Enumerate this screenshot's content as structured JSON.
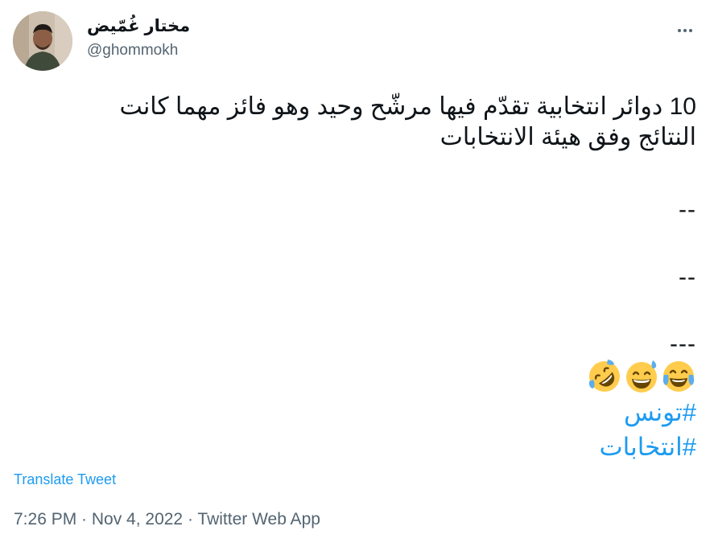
{
  "tweet": {
    "author": {
      "display_name": "مختار غُمّيض",
      "handle": "@ghommokh",
      "avatar_icon": "avatar-photo"
    },
    "more_icon": "ellipsis-icon",
    "text_lines": [
      "10 دوائر انتخابية تقدّم فيها مرشّح وحيد وهو فائز مهما كانت",
      "النتائج وفق هيئة الانتخابات"
    ],
    "separators": [
      "--",
      "--",
      "---"
    ],
    "emojis": [
      "face-with-tears-of-joy-icon",
      "grinning-face-with-sweat-icon",
      "rolling-on-floor-laughing-icon"
    ],
    "hashtags": [
      "#تونس",
      "#انتخابات"
    ],
    "translate_label": "Translate Tweet",
    "timestamp": "7:26 PM · Nov 4, 2022 · ",
    "source": "Twitter Web App"
  },
  "colors": {
    "link": "#1d9bf0",
    "secondary_text": "#536471",
    "primary_text": "#0f1419"
  }
}
